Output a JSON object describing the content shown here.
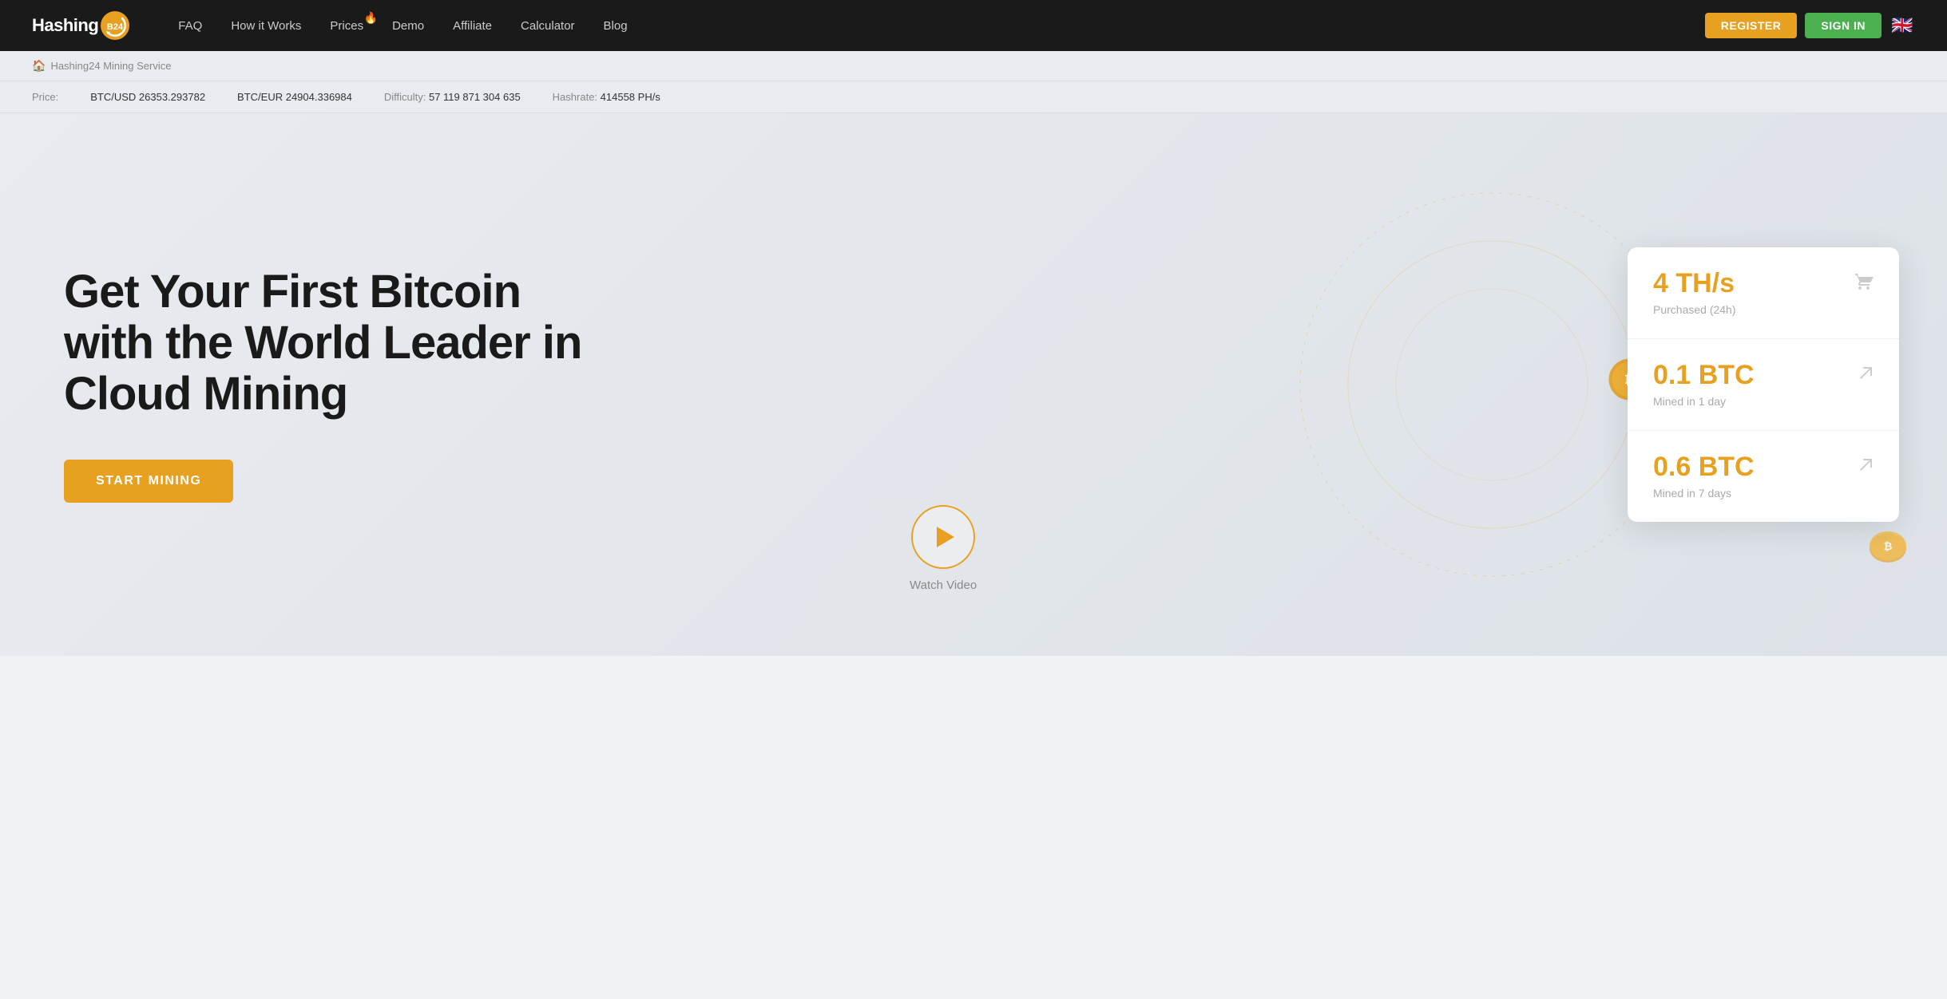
{
  "logo": {
    "text": "Hashing",
    "badge": "B24",
    "icon_symbol": "↺"
  },
  "nav": {
    "links": [
      {
        "id": "faq",
        "label": "FAQ",
        "hot": false
      },
      {
        "id": "how-it-works",
        "label": "How it Works",
        "hot": false
      },
      {
        "id": "prices",
        "label": "Prices",
        "hot": true
      },
      {
        "id": "demo",
        "label": "Demo",
        "hot": false
      },
      {
        "id": "affiliate",
        "label": "Affiliate",
        "hot": false
      },
      {
        "id": "calculator",
        "label": "Calculator",
        "hot": false
      },
      {
        "id": "blog",
        "label": "Blog",
        "hot": false
      }
    ],
    "register_label": "REGISTER",
    "signin_label": "SIGN IN",
    "flag": "🇬🇧"
  },
  "breadcrumb": {
    "home_label": "Hashing24 Mining Service"
  },
  "ticker": {
    "price_label": "Price:",
    "btc_usd": "BTC/USD 26353.293782",
    "btc_eur": "BTC/EUR 24904.336984",
    "difficulty_label": "Difficulty:",
    "difficulty_value": "57 119 871 304 635",
    "hashrate_label": "Hashrate:",
    "hashrate_value": "414558 PH/s"
  },
  "hero": {
    "title_line1": "Get Your First Bitcoin",
    "title_line2": "with the World Leader in",
    "title_line3": "Cloud Mining",
    "cta_label": "START MINING",
    "watch_video_label": "Watch Video"
  },
  "stats": [
    {
      "value": "4 TH/s",
      "label": "Purchased (24h)",
      "icon": "🛒"
    },
    {
      "value": "0.1 BTC",
      "label": "Mined in 1 day",
      "icon": "↗"
    },
    {
      "value": "0.6 BTC",
      "label": "Mined in 7 days",
      "icon": "↗"
    }
  ],
  "colors": {
    "accent": "#e8a020",
    "nav_bg": "#1a1a1a",
    "hero_bg": "#e8ebef",
    "cta_bg": "#e8a020",
    "signin_bg": "#4caf50"
  }
}
